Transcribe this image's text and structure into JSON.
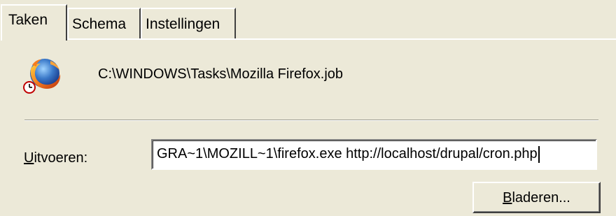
{
  "tabs": [
    {
      "label": "Taken",
      "active": true
    },
    {
      "label": "Schema",
      "active": false
    },
    {
      "label": "Instellingen",
      "active": false
    }
  ],
  "task": {
    "icon": "firefox-icon",
    "path": "C:\\WINDOWS\\Tasks\\Mozilla Firefox.job"
  },
  "run": {
    "label_accel": "U",
    "label_rest": "itvoeren:",
    "value_visible": "GRA~1\\MOZILL~1\\firefox.exe http://localhost/drupal/cron.php"
  },
  "browse": {
    "label_accel": "B",
    "label_rest": "laderen..."
  },
  "colors": {
    "dialog_bg": "#ece9d8",
    "field_bg": "#ffffff"
  }
}
